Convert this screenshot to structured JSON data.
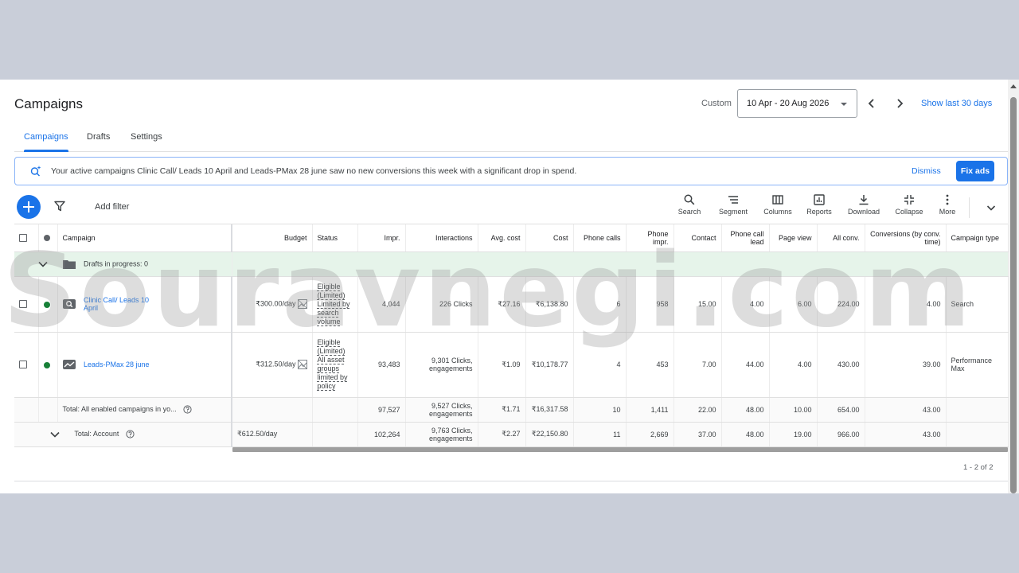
{
  "header": {
    "title": "Campaigns",
    "custom_label": "Custom",
    "date_range": "10 Apr - 20 Aug 2026",
    "show_last": "Show last 30 days"
  },
  "tabs": [
    {
      "label": "Campaigns"
    },
    {
      "label": "Drafts"
    },
    {
      "label": "Settings"
    }
  ],
  "banner": {
    "message": "Your active campaigns Clinic Call/ Leads 10 April and Leads-PMax 28 june saw no new conversions this week with a significant drop in spend.",
    "dismiss": "Dismiss",
    "fix": "Fix ads"
  },
  "toolbar": {
    "add_filter": "Add filter",
    "tools": [
      {
        "label": "Search",
        "icon": "search-icon"
      },
      {
        "label": "Segment",
        "icon": "segment-icon"
      },
      {
        "label": "Columns",
        "icon": "columns-icon"
      },
      {
        "label": "Reports",
        "icon": "reports-icon"
      },
      {
        "label": "Download",
        "icon": "download-icon"
      },
      {
        "label": "Collapse",
        "icon": "collapse-icon"
      },
      {
        "label": "More",
        "icon": "more-vert-icon"
      }
    ]
  },
  "table": {
    "headers": {
      "campaign": "Campaign",
      "budget": "Budget",
      "status": "Status",
      "impr": "Impr.",
      "interactions": "Interactions",
      "avg_cost": "Avg. cost",
      "cost": "Cost",
      "phone_calls": "Phone calls",
      "phone_impr": "Phone impr.",
      "contact": "Contact",
      "phone_call_lead": "Phone call lead",
      "page_view": "Page view",
      "all_conv": "All conv.",
      "conv_by_time": "Conversions (by conv. time)",
      "campaign_type": "Campaign type"
    },
    "drafts_label": "Drafts in progress: 0",
    "rows": [
      {
        "name": "Clinic Call/ Leads 10 April",
        "budget": "₹300.00/day",
        "status": "Eligible (Limited) Limited by search volume",
        "impr": "4,044",
        "interactions": "226 Clicks",
        "avg_cost": "₹27.16",
        "cost": "₹6,138.80",
        "phone_calls": "6",
        "phone_impr": "958",
        "contact": "15.00",
        "phone_call_lead": "4.00",
        "page_view": "6.00",
        "all_conv": "224.00",
        "conv_by_time": "4.00",
        "campaign_type": "Search"
      },
      {
        "name": "Leads-PMax 28 june",
        "budget": "₹312.50/day",
        "status": "Eligible (Limited) All asset groups limited by policy",
        "impr": "93,483",
        "interactions": "9,301 Clicks, engagements",
        "avg_cost": "₹1.09",
        "cost": "₹10,178.77",
        "phone_calls": "4",
        "phone_impr": "453",
        "contact": "7.00",
        "phone_call_lead": "44.00",
        "page_view": "4.00",
        "all_conv": "430.00",
        "conv_by_time": "39.00",
        "campaign_type": "Performance Max"
      }
    ],
    "totals": [
      {
        "label": "Total: All enabled campaigns in yo...",
        "budget": "",
        "impr": "97,527",
        "interactions": "9,527 Clicks, engagements",
        "avg_cost": "₹1.71",
        "cost": "₹16,317.58",
        "phone_calls": "10",
        "phone_impr": "1,411",
        "contact": "22.00",
        "phone_call_lead": "48.00",
        "page_view": "10.00",
        "all_conv": "654.00",
        "conv_by_time": "43.00"
      },
      {
        "label": "Total: Account",
        "budget": "₹612.50/day",
        "impr": "102,264",
        "interactions": "9,763 Clicks, engagements",
        "avg_cost": "₹2.27",
        "cost": "₹22,150.80",
        "phone_calls": "11",
        "phone_impr": "2,669",
        "contact": "37.00",
        "phone_call_lead": "48.00",
        "page_view": "19.00",
        "all_conv": "966.00",
        "conv_by_time": "43.00"
      }
    ]
  },
  "pagination": "1 - 2 of 2",
  "watermark": "Souravnegi.com",
  "colors": {
    "accent": "#1a73e8",
    "enabled_green": "#188038",
    "drafts_bg": "#e6f4ea",
    "outer_bg": "#c9ced9"
  }
}
